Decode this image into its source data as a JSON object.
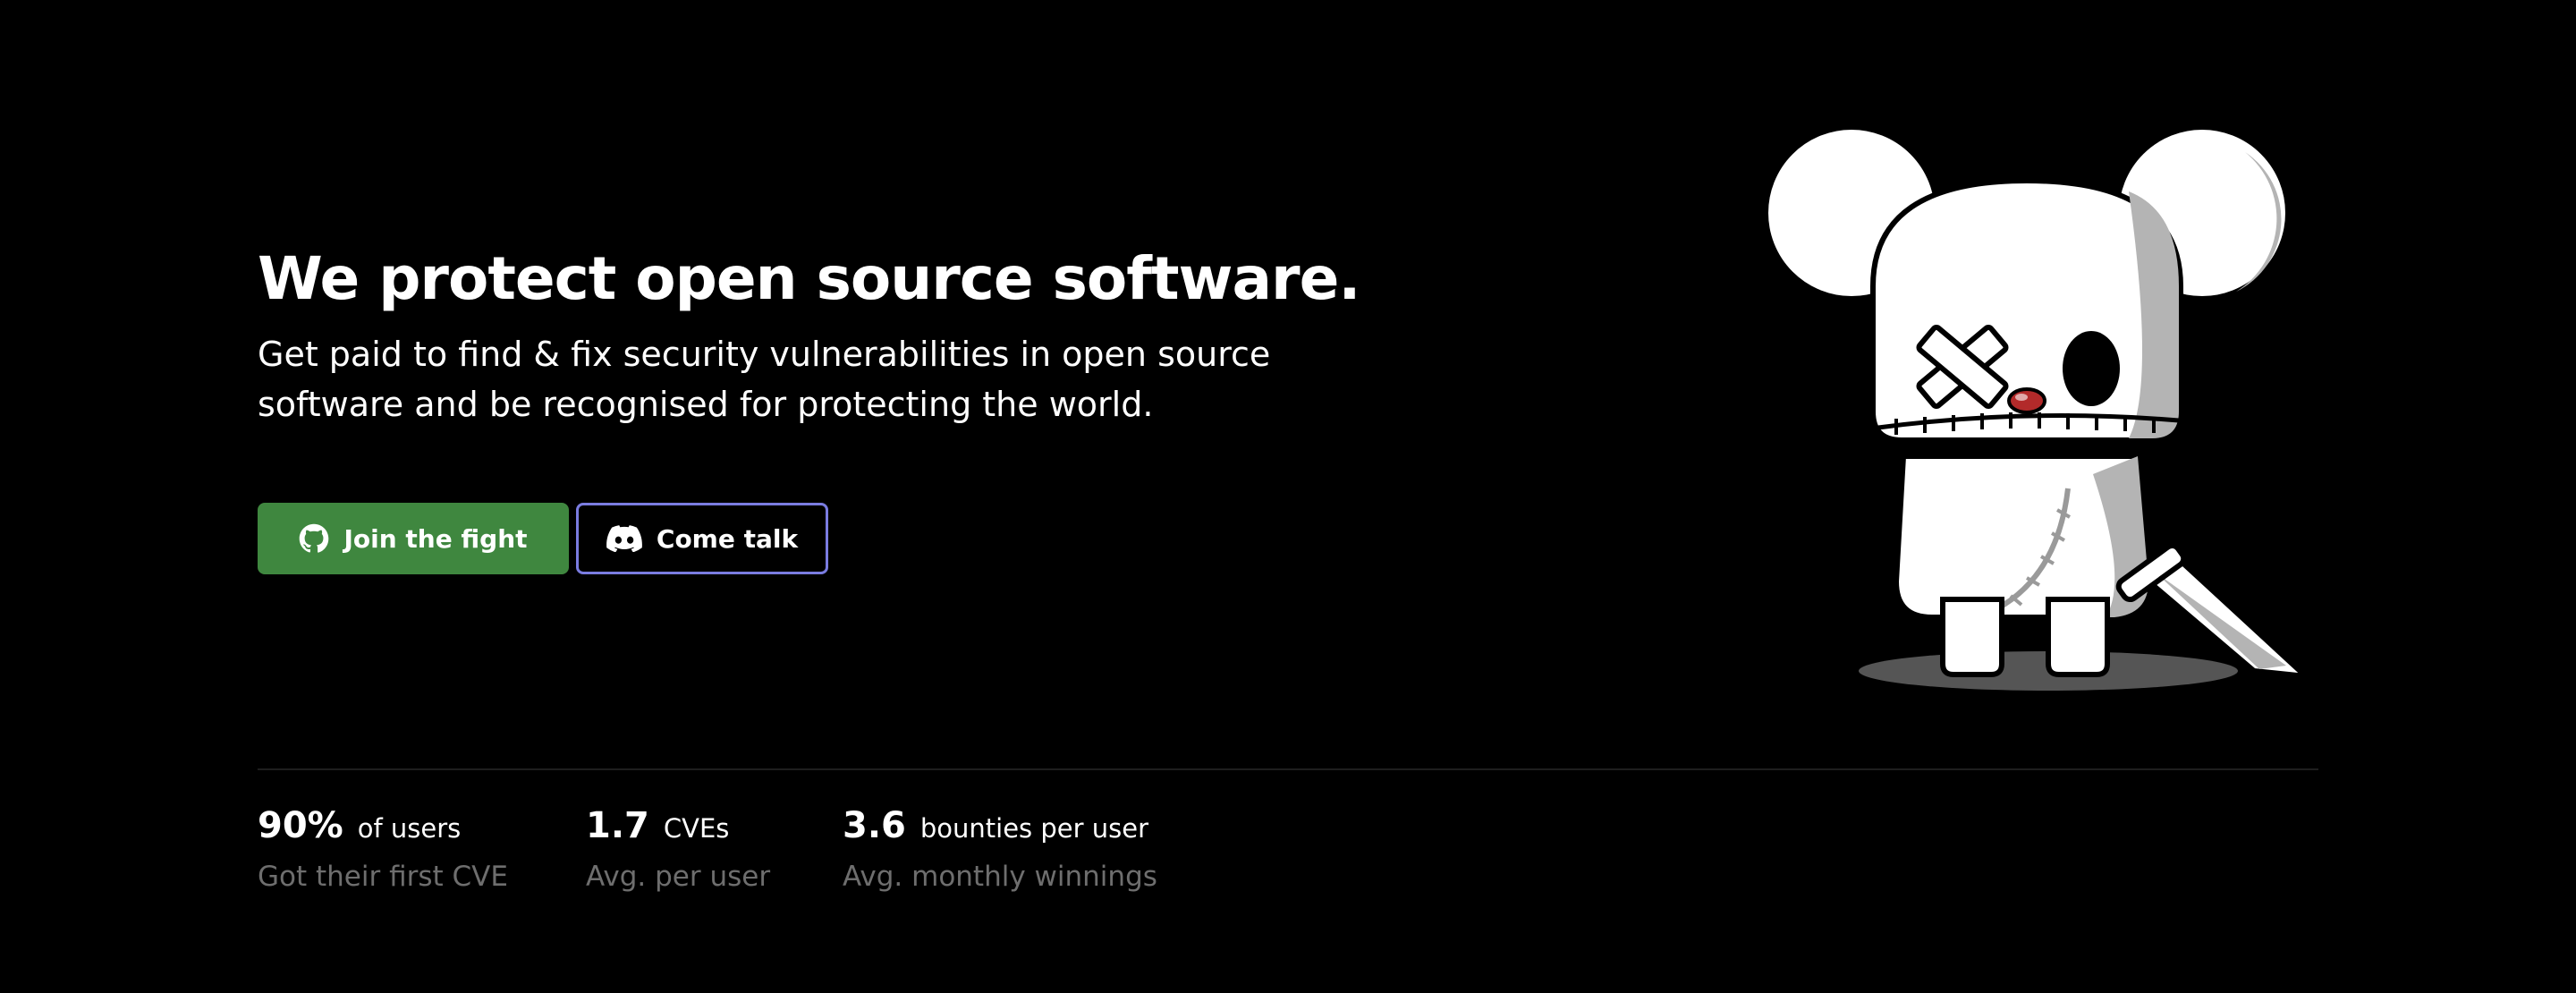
{
  "hero": {
    "title": "We protect open source software.",
    "subtitle": "Get paid to find & fix security vulnerabilities in open source software and be recognised for protecting the world."
  },
  "buttons": {
    "join": {
      "label": "Join the fight",
      "icon": "github-icon",
      "color": "#3f873f"
    },
    "talk": {
      "label": "Come talk",
      "icon": "discord-icon",
      "border_color": "#7a7ce0"
    }
  },
  "stats": [
    {
      "value": "90%",
      "unit": "of users",
      "caption": "Got their first CVE"
    },
    {
      "value": "1.7",
      "unit": "CVEs",
      "caption": "Avg. per user"
    },
    {
      "value": "3.6",
      "unit": "bounties per user",
      "caption": "Avg. monthly winnings"
    }
  ],
  "mascot": {
    "icon": "bear-mascot-with-sword"
  },
  "colors": {
    "background": "#000000",
    "caption_gray": "#6e6e6e"
  }
}
